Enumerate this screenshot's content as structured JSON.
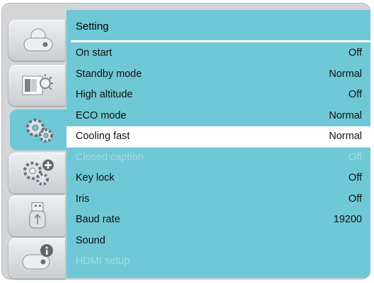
{
  "sidebar": {
    "tabs": [
      {
        "icon": "projector-icon",
        "active": false
      },
      {
        "icon": "image-brightness-icon",
        "active": false
      },
      {
        "icon": "gears-icon",
        "active": true
      },
      {
        "icon": "gears-plus-icon",
        "active": false
      },
      {
        "icon": "usb-icon",
        "active": false
      },
      {
        "icon": "projector-info-icon",
        "active": false
      }
    ]
  },
  "panel": {
    "title": "Setting",
    "rows": [
      {
        "label": "On start",
        "value": "Off",
        "state": "normal"
      },
      {
        "label": "Standby mode",
        "value": "Normal",
        "state": "normal"
      },
      {
        "label": "High altitude",
        "value": "Off",
        "state": "normal"
      },
      {
        "label": "ECO mode",
        "value": "Normal",
        "state": "normal"
      },
      {
        "label": "Cooling fast",
        "value": "Normal",
        "state": "selected"
      },
      {
        "label": "Closed caption",
        "value": "Off",
        "state": "disabled"
      },
      {
        "label": "Key lock",
        "value": "Off",
        "state": "normal"
      },
      {
        "label": "Iris",
        "value": "Off",
        "state": "normal"
      },
      {
        "label": "Baud rate",
        "value": "19200",
        "state": "normal"
      },
      {
        "label": "Sound",
        "value": "",
        "state": "normal"
      },
      {
        "label": "HDMI setup",
        "value": "",
        "state": "disabled"
      }
    ]
  },
  "colors": {
    "panel": "#6fc8d5",
    "selected_row": "#ffffff",
    "disabled_text": "#a6dbe3",
    "frame": "#d3d5d7"
  }
}
